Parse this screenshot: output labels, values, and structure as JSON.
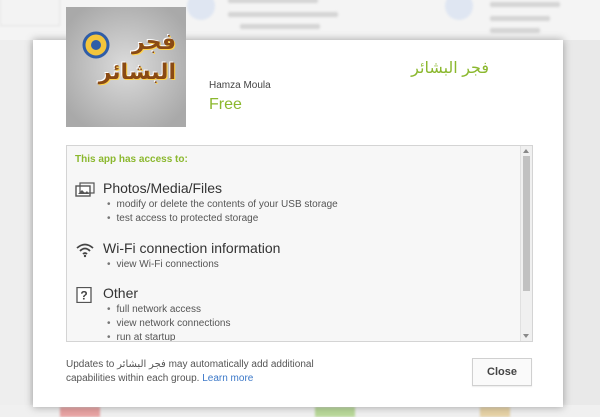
{
  "app": {
    "logo_line1": "فجر",
    "logo_line2": "البشائر",
    "title": "فجر البشائر",
    "developer": "Hamza Moula",
    "price": "Free"
  },
  "permissions": {
    "header": "This app has access to:",
    "groups": [
      {
        "icon": "photo-media-icon",
        "title": "Photos/Media/Files",
        "items": [
          "modify or delete the contents of your USB storage",
          "test access to protected storage"
        ]
      },
      {
        "icon": "wifi-icon",
        "title": "Wi-Fi connection information",
        "items": [
          "view Wi-Fi connections"
        ]
      },
      {
        "icon": "question-box-icon",
        "title": "Other",
        "items": [
          "full network access",
          "view network connections",
          "run at startup"
        ]
      }
    ]
  },
  "footer": {
    "note_prefix": "Updates to ",
    "note_app": "فجر البشائر",
    "note_suffix": " may automatically add additional capabilities within each group. ",
    "learn_more": "Learn more",
    "close_label": "Close"
  },
  "colors": {
    "accent_green": "#8bb82e",
    "link_blue": "#3b78c8"
  }
}
